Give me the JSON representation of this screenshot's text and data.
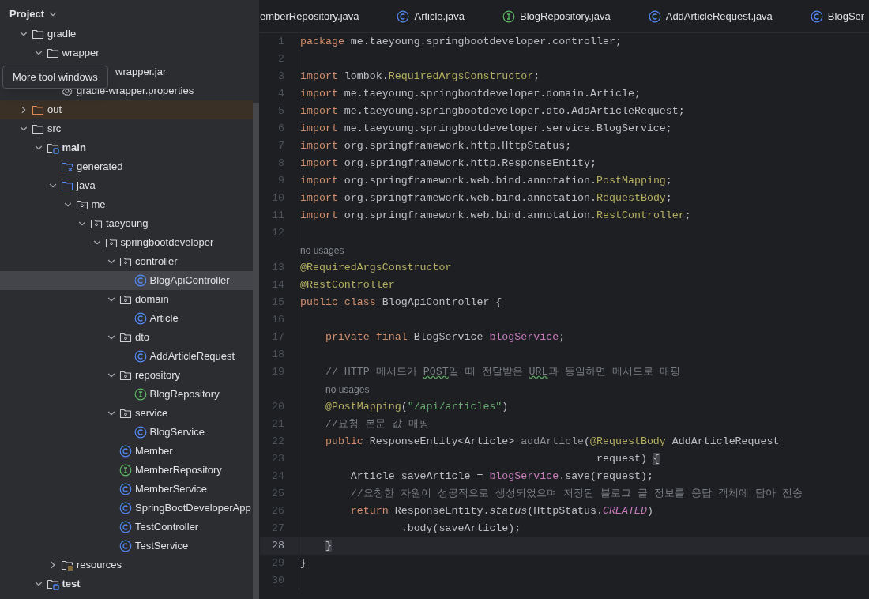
{
  "project_header": {
    "title": "Project"
  },
  "tooltip": {
    "text": "More tool windows"
  },
  "tree": [
    {
      "label": "gradle",
      "kind": "folder",
      "expanded": true,
      "selected": false,
      "children": [
        {
          "label": "wrapper",
          "kind": "folder",
          "expanded": true,
          "selected": false,
          "children": [
            {
              "label": "wrapper.jar",
              "kind": "file",
              "under_tooltip": true,
              "selected": false
            },
            {
              "label": "gradle-wrapper.properties",
              "kind": "properties",
              "under_tooltip": false,
              "selected": false
            }
          ]
        }
      ]
    },
    {
      "label": "out",
      "kind": "excluded-folder",
      "expanded": false,
      "selected": false
    },
    {
      "label": "src",
      "kind": "folder",
      "expanded": true,
      "selected": false,
      "children": [
        {
          "label": "main",
          "kind": "source-root",
          "expanded": true,
          "selected": false,
          "children": [
            {
              "label": "generated",
              "kind": "generated-root",
              "selected": false
            },
            {
              "label": "java",
              "kind": "source-folder",
              "expanded": true,
              "selected": false,
              "children": [
                {
                  "label": "me",
                  "kind": "package",
                  "expanded": true,
                  "selected": false,
                  "children": [
                    {
                      "label": "taeyoung",
                      "kind": "package",
                      "expanded": true,
                      "selected": false,
                      "children": [
                        {
                          "label": "springbootdeveloper",
                          "kind": "package",
                          "expanded": true,
                          "selected": false,
                          "children": [
                            {
                              "label": "controller",
                              "kind": "package",
                              "expanded": true,
                              "selected": false,
                              "children": [
                                {
                                  "label": "BlogApiController",
                                  "kind": "class",
                                  "selected": true
                                }
                              ]
                            },
                            {
                              "label": "domain",
                              "kind": "package",
                              "expanded": true,
                              "selected": false,
                              "children": [
                                {
                                  "label": "Article",
                                  "kind": "class",
                                  "selected": false
                                }
                              ]
                            },
                            {
                              "label": "dto",
                              "kind": "package",
                              "expanded": true,
                              "selected": false,
                              "children": [
                                {
                                  "label": "AddArticleRequest",
                                  "kind": "class",
                                  "selected": false
                                }
                              ]
                            },
                            {
                              "label": "repository",
                              "kind": "package",
                              "expanded": true,
                              "selected": false,
                              "children": [
                                {
                                  "label": "BlogRepository",
                                  "kind": "interface",
                                  "selected": false
                                }
                              ]
                            },
                            {
                              "label": "service",
                              "kind": "package",
                              "expanded": true,
                              "selected": false,
                              "children": [
                                {
                                  "label": "BlogService",
                                  "kind": "class",
                                  "selected": false
                                }
                              ]
                            },
                            {
                              "label": "Member",
                              "kind": "class",
                              "selected": false
                            },
                            {
                              "label": "MemberRepository",
                              "kind": "interface",
                              "selected": false
                            },
                            {
                              "label": "MemberService",
                              "kind": "class",
                              "selected": false
                            },
                            {
                              "label": "SpringBootDeveloperApp",
                              "kind": "class",
                              "selected": false
                            },
                            {
                              "label": "TestController",
                              "kind": "class",
                              "selected": false
                            },
                            {
                              "label": "TestService",
                              "kind": "class",
                              "selected": false
                            }
                          ]
                        }
                      ]
                    }
                  ]
                }
              ]
            },
            {
              "label": "resources",
              "kind": "resources-folder",
              "expanded": false,
              "selected": false
            }
          ]
        },
        {
          "label": "test",
          "kind": "source-root",
          "expanded": true,
          "selected": false
        }
      ]
    }
  ],
  "tabs": [
    {
      "label": "emberRepository.java",
      "kind": "cut",
      "selected": false
    },
    {
      "label": "Article.java",
      "kind": "class",
      "selected": false
    },
    {
      "label": "BlogRepository.java",
      "kind": "interface",
      "selected": false
    },
    {
      "label": "AddArticleRequest.java",
      "kind": "class",
      "selected": false
    },
    {
      "label": "BlogSer",
      "kind": "class",
      "selected": false
    }
  ],
  "code_lines": [
    {
      "kind": "code",
      "number": "1",
      "current": false,
      "tokens": [
        {
          "kind": "keyword",
          "text": "package"
        },
        {
          "kind": "plain",
          "text": " me.taeyoung.springbootdeveloper.controller;"
        }
      ]
    },
    {
      "kind": "code",
      "number": "2",
      "current": false
    },
    {
      "kind": "code",
      "number": "3",
      "current": false,
      "tokens": [
        {
          "kind": "keyword",
          "text": "import"
        },
        {
          "kind": "plain",
          "text": " lombok."
        },
        {
          "kind": "annotation",
          "text": "RequiredArgsConstructor"
        },
        {
          "kind": "plain",
          "text": ";"
        }
      ]
    },
    {
      "kind": "code",
      "number": "4",
      "current": false,
      "tokens": [
        {
          "kind": "keyword",
          "text": "import"
        },
        {
          "kind": "plain",
          "text": " me.taeyoung.springbootdeveloper.domain.Article;"
        }
      ]
    },
    {
      "kind": "code",
      "number": "5",
      "current": false,
      "tokens": [
        {
          "kind": "keyword",
          "text": "import"
        },
        {
          "kind": "plain",
          "text": " me.taeyoung.springbootdeveloper.dto.AddArticleRequest;"
        }
      ]
    },
    {
      "kind": "code",
      "number": "6",
      "current": false,
      "tokens": [
        {
          "kind": "keyword",
          "text": "import"
        },
        {
          "kind": "plain",
          "text": " me.taeyoung.springbootdeveloper.service.BlogService;"
        }
      ]
    },
    {
      "kind": "code",
      "number": "7",
      "current": false,
      "tokens": [
        {
          "kind": "keyword",
          "text": "import"
        },
        {
          "kind": "plain",
          "text": " org.springframework.http.HttpStatus;"
        }
      ]
    },
    {
      "kind": "code",
      "number": "8",
      "current": false,
      "tokens": [
        {
          "kind": "keyword",
          "text": "import"
        },
        {
          "kind": "plain",
          "text": " org.springframework.http.ResponseEntity;"
        }
      ]
    },
    {
      "kind": "code",
      "number": "9",
      "current": false,
      "tokens": [
        {
          "kind": "keyword",
          "text": "import"
        },
        {
          "kind": "plain",
          "text": " org.springframework.web.bind.annotation."
        },
        {
          "kind": "annotation",
          "text": "PostMapping"
        },
        {
          "kind": "plain",
          "text": ";"
        }
      ]
    },
    {
      "kind": "code",
      "number": "10",
      "current": false,
      "tokens": [
        {
          "kind": "keyword",
          "text": "import"
        },
        {
          "kind": "plain",
          "text": " org.springframework.web.bind.annotation."
        },
        {
          "kind": "annotation",
          "text": "RequestBody"
        },
        {
          "kind": "plain",
          "text": ";"
        }
      ]
    },
    {
      "kind": "code",
      "number": "11",
      "current": false,
      "tokens": [
        {
          "kind": "keyword",
          "text": "import"
        },
        {
          "kind": "plain",
          "text": " org.springframework.web.bind.annotation."
        },
        {
          "kind": "annotation",
          "text": "RestController"
        },
        {
          "kind": "plain",
          "text": ";"
        }
      ]
    },
    {
      "kind": "code",
      "number": "12",
      "current": false
    },
    {
      "kind": "hint",
      "text": "no usages",
      "indent": false
    },
    {
      "kind": "code",
      "number": "13",
      "current": false,
      "tokens": [
        {
          "kind": "annotation",
          "text": "@RequiredArgsConstructor"
        }
      ]
    },
    {
      "kind": "code",
      "number": "14",
      "current": false,
      "tokens": [
        {
          "kind": "annotation",
          "text": "@RestController"
        }
      ]
    },
    {
      "kind": "code",
      "number": "15",
      "current": false,
      "tokens": [
        {
          "kind": "keyword",
          "text": "public class"
        },
        {
          "kind": "plain",
          "text": " BlogApiController {"
        }
      ]
    },
    {
      "kind": "code",
      "number": "16",
      "current": false
    },
    {
      "kind": "code",
      "number": "17",
      "current": false,
      "tokens": [
        {
          "kind": "keyword",
          "text": "    private final"
        },
        {
          "kind": "plain",
          "text": " BlogService "
        },
        {
          "kind": "field",
          "text": "blogService"
        },
        {
          "kind": "plain",
          "text": ";"
        }
      ]
    },
    {
      "kind": "code",
      "number": "18",
      "current": false
    },
    {
      "kind": "code",
      "number": "19",
      "current": false,
      "tokens": [
        {
          "kind": "comment",
          "text": "    // HTTP 메서드가 "
        },
        {
          "kind": "typo",
          "text": "POST"
        },
        {
          "kind": "comment",
          "text": "일 때 전달받은 "
        },
        {
          "kind": "typo",
          "text": "URL"
        },
        {
          "kind": "comment",
          "text": "과 동일하면 메서드로 매핑"
        }
      ]
    },
    {
      "kind": "hint",
      "text": "no usages",
      "indent": true
    },
    {
      "kind": "code",
      "number": "20",
      "current": false,
      "tokens": [
        {
          "kind": "annotation",
          "text": "    @PostMapping"
        },
        {
          "kind": "plain",
          "text": "("
        },
        {
          "kind": "string",
          "text": "\"/api/articles\""
        },
        {
          "kind": "plain",
          "text": ")"
        }
      ]
    },
    {
      "kind": "code",
      "number": "21",
      "current": false,
      "tokens": [
        {
          "kind": "comment",
          "text": "    //요청 본문 값 매핑"
        }
      ]
    },
    {
      "kind": "code",
      "number": "22",
      "current": false,
      "tokens": [
        {
          "kind": "keyword",
          "text": "    public"
        },
        {
          "kind": "plain",
          "text": " ResponseEntity<Article> "
        },
        {
          "kind": "unused",
          "text": "addArticle"
        },
        {
          "kind": "plain",
          "text": "("
        },
        {
          "kind": "annotation",
          "text": "@RequestBody"
        },
        {
          "kind": "plain",
          "text": " AddArticleRequest"
        }
      ]
    },
    {
      "kind": "code",
      "number": "23",
      "current": false,
      "tokens": [
        {
          "kind": "plain",
          "text": "                                               request) "
        },
        {
          "kind": "match",
          "text": "{"
        }
      ]
    },
    {
      "kind": "code",
      "number": "24",
      "current": false,
      "tokens": [
        {
          "kind": "plain",
          "text": "        Article saveArticle = "
        },
        {
          "kind": "field",
          "text": "blogService"
        },
        {
          "kind": "plain",
          "text": ".save(request);"
        }
      ]
    },
    {
      "kind": "code",
      "number": "25",
      "current": false,
      "tokens": [
        {
          "kind": "comment",
          "text": "        //요청한 자원이 성공적으로 생성되었으며 저장된 블로그 글 정보를 응답 객체에 담아 전송"
        }
      ]
    },
    {
      "kind": "code",
      "number": "26",
      "current": false,
      "tokens": [
        {
          "kind": "keyword",
          "text": "        return"
        },
        {
          "kind": "plain",
          "text": " ResponseEntity."
        },
        {
          "kind": "static",
          "text": "status"
        },
        {
          "kind": "plain",
          "text": "(HttpStatus."
        },
        {
          "kind": "constant",
          "text": "CREATED"
        },
        {
          "kind": "plain",
          "text": ")"
        }
      ]
    },
    {
      "kind": "code",
      "number": "27",
      "current": false,
      "tokens": [
        {
          "kind": "plain",
          "text": "                .body(saveArticle);"
        }
      ]
    },
    {
      "kind": "code",
      "number": "28",
      "current": true,
      "tokens": [
        {
          "kind": "match",
          "text": "    }"
        }
      ]
    },
    {
      "kind": "code",
      "number": "29",
      "current": false,
      "tokens": [
        {
          "kind": "plain",
          "text": "}"
        }
      ]
    },
    {
      "kind": "code",
      "number": "30",
      "current": false
    }
  ]
}
